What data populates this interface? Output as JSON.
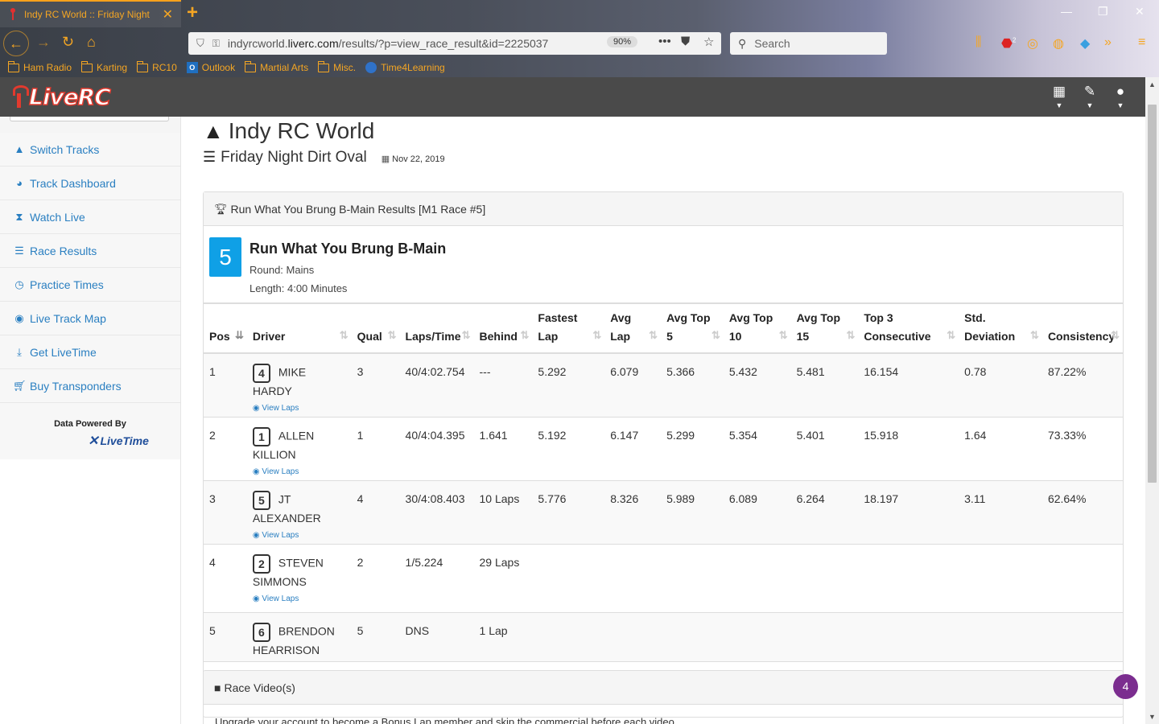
{
  "browser": {
    "tab_title": "Indy RC World :: Friday Night",
    "tab_close": "✕",
    "new_tab": "+",
    "url_scheme_host": "indyrcworld.",
    "url_domain": "liverc.com",
    "url_path": "/results/?p=view_race_result&id=2225037",
    "zoom": "90%",
    "search_placeholder": "Search",
    "bookmarks": [
      "Ham Radio",
      "Karting",
      "RC10",
      "Outlook",
      "Martial Arts",
      "Misc.",
      "Time4Learning"
    ],
    "abp_count": "2"
  },
  "site": {
    "logo_text": "LiveRC"
  },
  "sidebar": {
    "items": [
      {
        "label": "Switch Tracks",
        "icon": "road-icon"
      },
      {
        "label": "Track Dashboard",
        "icon": "dashboard-icon"
      },
      {
        "label": "Watch Live",
        "icon": "hourglass-icon"
      },
      {
        "label": "Race Results",
        "icon": "list-icon"
      },
      {
        "label": "Practice Times",
        "icon": "clock-icon"
      },
      {
        "label": "Live Track Map",
        "icon": "globe-icon"
      },
      {
        "label": "Get LiveTime",
        "icon": "download-icon"
      },
      {
        "label": "Buy Transponders",
        "icon": "cart-icon"
      }
    ],
    "powered_by": "Data Powered By",
    "livetime_label": "LiveTime"
  },
  "page": {
    "track_name": "Indy RC World",
    "event_name": "Friday Night Dirt Oval",
    "event_date": "Nov 22, 2019"
  },
  "race": {
    "panel_title": "Run What You Brung B-Main Results [M1 Race #5]",
    "number": "5",
    "name": "Run What You Brung B-Main",
    "round": "Round: Mains",
    "length": "Length: 4:00 Minutes",
    "view_laps_label": "View Laps"
  },
  "table": {
    "headers": [
      "Pos",
      "Driver",
      "Qual",
      "Laps/Time",
      "Behind",
      "Fastest Lap",
      "Avg Lap",
      "Avg Top 5",
      "Avg Top 10",
      "Avg Top 15",
      "Top 3 Consecutive",
      "Std. Deviation",
      "Consistency"
    ],
    "headers_wrapped": [
      [
        "Pos"
      ],
      [
        "Driver"
      ],
      [
        "Qual"
      ],
      [
        "Laps/Time"
      ],
      [
        "Behind"
      ],
      [
        "Fastest",
        "Lap"
      ],
      [
        "Avg",
        "Lap"
      ],
      [
        "Avg Top",
        "5"
      ],
      [
        "Avg Top",
        "10"
      ],
      [
        "Avg Top",
        "15"
      ],
      [
        "Top 3",
        "Consecutive"
      ],
      [
        "Std.",
        "Deviation"
      ],
      [
        "Consistency"
      ]
    ],
    "rows": [
      {
        "pos": "1",
        "car": "4",
        "driver": "MIKE HARDY",
        "qual": "3",
        "laps_time": "40/4:02.754",
        "behind": "---",
        "fastest": "5.292",
        "avg": "6.079",
        "top5": "5.366",
        "top10": "5.432",
        "top15": "5.481",
        "top3c": "16.154",
        "std": "0.78",
        "consistency": "87.22%",
        "view_laps": true
      },
      {
        "pos": "2",
        "car": "1",
        "driver": "ALLEN KILLION",
        "qual": "1",
        "laps_time": "40/4:04.395",
        "behind": "1.641",
        "fastest": "5.192",
        "avg": "6.147",
        "top5": "5.299",
        "top10": "5.354",
        "top15": "5.401",
        "top3c": "15.918",
        "std": "1.64",
        "consistency": "73.33%",
        "view_laps": true
      },
      {
        "pos": "3",
        "car": "5",
        "driver": "JT ALEXANDER",
        "qual": "4",
        "laps_time": "30/4:08.403",
        "behind": "10 Laps",
        "fastest": "5.776",
        "avg": "8.326",
        "top5": "5.989",
        "top10": "6.089",
        "top15": "6.264",
        "top3c": "18.197",
        "std": "3.11",
        "consistency": "62.64%",
        "view_laps": true
      },
      {
        "pos": "4",
        "car": "2",
        "driver": "STEVEN SIMMONS",
        "qual": "2",
        "laps_time": "1/5.224",
        "behind": "29 Laps",
        "fastest": "",
        "avg": "",
        "top5": "",
        "top10": "",
        "top15": "",
        "top3c": "",
        "std": "",
        "consistency": "",
        "view_laps": true
      },
      {
        "pos": "5",
        "car": "6",
        "driver": "BRENDON HEARRISON",
        "qual": "5",
        "laps_time": "DNS",
        "behind": "1 Lap",
        "fastest": "",
        "avg": "",
        "top5": "",
        "top10": "",
        "top15": "",
        "top3c": "",
        "std": "",
        "consistency": "",
        "view_laps": false
      }
    ]
  },
  "videos": {
    "title": "Race Video(s)",
    "body": "Upgrade your account to become a Bonus Lap member and skip the commercial before each video"
  },
  "notification_count": "4",
  "colors": {
    "accent": "#2a7fc1",
    "race_badge": "#0fa0e6",
    "browser_accent": "#f5a623",
    "notif": "#7b2d8f"
  }
}
